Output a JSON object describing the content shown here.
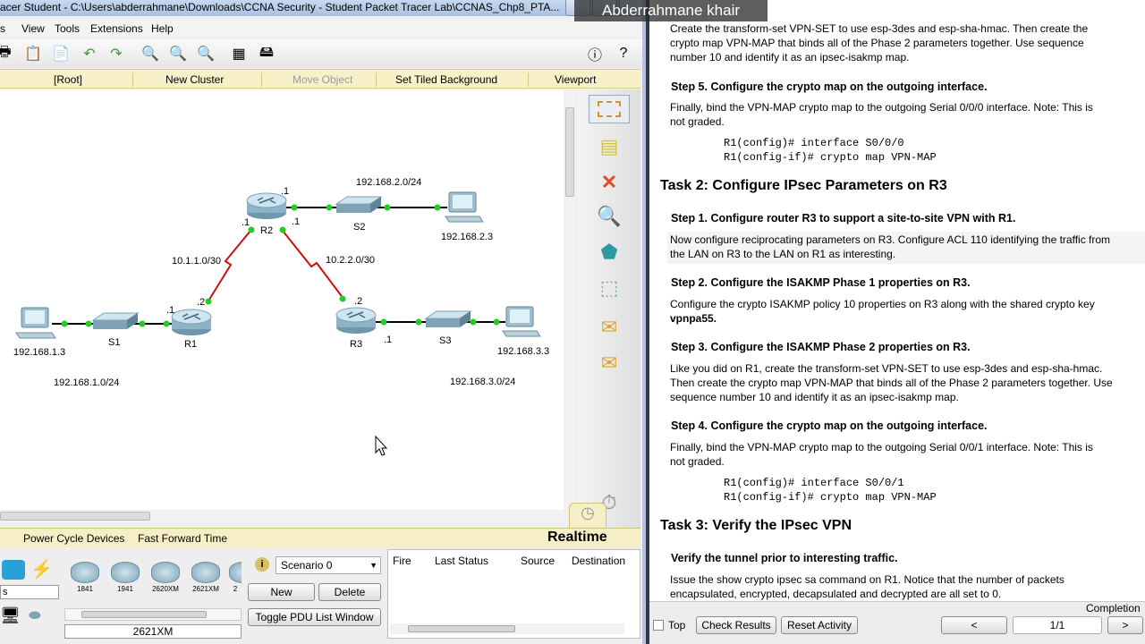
{
  "window": {
    "title": "acer Student - C:\\Users\\abderrahmane\\Downloads\\CCNA Security - Student Packet Tracer Lab\\CCNAS_Chp8_PTA..."
  },
  "watermark": "Abderrahmane khair",
  "menu": [
    "s",
    "View",
    "Tools",
    "Extensions",
    "Help"
  ],
  "logical_bar": {
    "root": "[Root]",
    "new_cluster": "New Cluster",
    "move_object": "Move Object",
    "set_bg": "Set Tiled Background",
    "viewport": "Viewport"
  },
  "topology": {
    "devices": {
      "r1": "R1",
      "r2": "R2",
      "r3": "R3",
      "s1": "S1",
      "s2": "S2",
      "s3": "S3"
    },
    "labels": {
      "net_r2": "192.168.2.0/24",
      "pc2": "192.168.2.3",
      "link_r1r2": "10.1.1.0/30",
      "link_r2r3": "10.2.2.0/30",
      "pc1": "192.168.1.3",
      "pc3": "192.168.3.3",
      "net1": "192.168.1.0/24",
      "net3": "192.168.3.0/24",
      "r2_lan": ".1",
      "r2_s0": ".1",
      "r2_s1": ".1",
      "r1_s0": ".2",
      "r1_lan": ".1",
      "r3_s0": ".2",
      "r3_lan": ".1"
    }
  },
  "realtime": {
    "power_cycle": "Power Cycle Devices",
    "fast_forward": "Fast Forward Time",
    "mode": "Realtime"
  },
  "device_panel": {
    "models": [
      "1841",
      "1941",
      "2620XM",
      "2621XM",
      "2"
    ],
    "category": "s",
    "selected_model": "2621XM"
  },
  "scenario": {
    "value": "Scenario 0",
    "new": "New",
    "delete": "Delete",
    "toggle": "Toggle PDU List Window"
  },
  "pdu_list": {
    "fire": "Fire",
    "last_status": "Last Status",
    "source": "Source",
    "destination": "Destination"
  },
  "doc": {
    "l1": "Create the transform-set VPN-SET to use esp-3des and esp-sha-hmac. Then create the",
    "l2": "crypto map VPN-MAP that binds all of the Phase 2 parameters together. Use sequence",
    "l3": "number 10 and identify it as an ipsec-isakmp map.",
    "s5": "Step 5. Configure the crypto map on the outgoing interface.",
    "s5a": "Finally, bind the VPN-MAP crypto map to the outgoing Serial 0/0/0 interface. Note: This is",
    "s5b": "not graded.",
    "c1": "R1(config)# interface S0/0/0",
    "c2": "R1(config-if)# crypto map VPN-MAP",
    "task2": "Task 2: Configure IPsec Parameters on R3",
    "t2s1": "Step 1. Configure router R3 to support a site-to-site VPN with R1.",
    "t2s1a": "Now configure reciprocating parameters on R3. Configure ACL 110 identifying the traffic from",
    "t2s1b": "the LAN on R3 to the LAN on R1 as interesting.",
    "t2s2": "Step 2. Configure the ISAKMP Phase 1 properties on R3.",
    "t2s2a": "Configure the crypto ISAKMP policy 10 properties on R3 along with the shared crypto key",
    "t2s2b": "vpnpa55.",
    "t2s3": "Step 3. Configure the ISAKMP Phase 2 properties on R3.",
    "t2s3a": "Like you did on R1, create the transform-set VPN-SET to use esp-3des and esp-sha-hmac.",
    "t2s3b": "Then create the crypto map VPN-MAP that binds all of the Phase 2 parameters together. Use",
    "t2s3c": "sequence number 10 and identify it as an ipsec-isakmp map.",
    "t2s4": "Step 4. Configure the crypto map on the outgoing interface.",
    "t2s4a": "Finally, bind the VPN-MAP crypto map to the outgoing Serial 0/0/1 interface. Note: This is",
    "t2s4b": "not graded.",
    "c3": "R1(config)# interface S0/0/1",
    "c4": "R1(config-if)# crypto map VPN-MAP",
    "task3": "Task 3: Verify the IPsec VPN",
    "t3h": "Verify the tunnel prior to interesting traffic.",
    "t3a": "Issue the show crypto ipsec sa command on R1. Notice that the number of packets",
    "t3b": "encapsulated, encrypted, decapsulated and decrypted are all set to 0."
  },
  "doc_bar": {
    "completion": "Completion",
    "top": "Top",
    "check": "Check Results",
    "reset": "Reset Activity",
    "prev": "<",
    "page": "1/1",
    "next": ">"
  }
}
